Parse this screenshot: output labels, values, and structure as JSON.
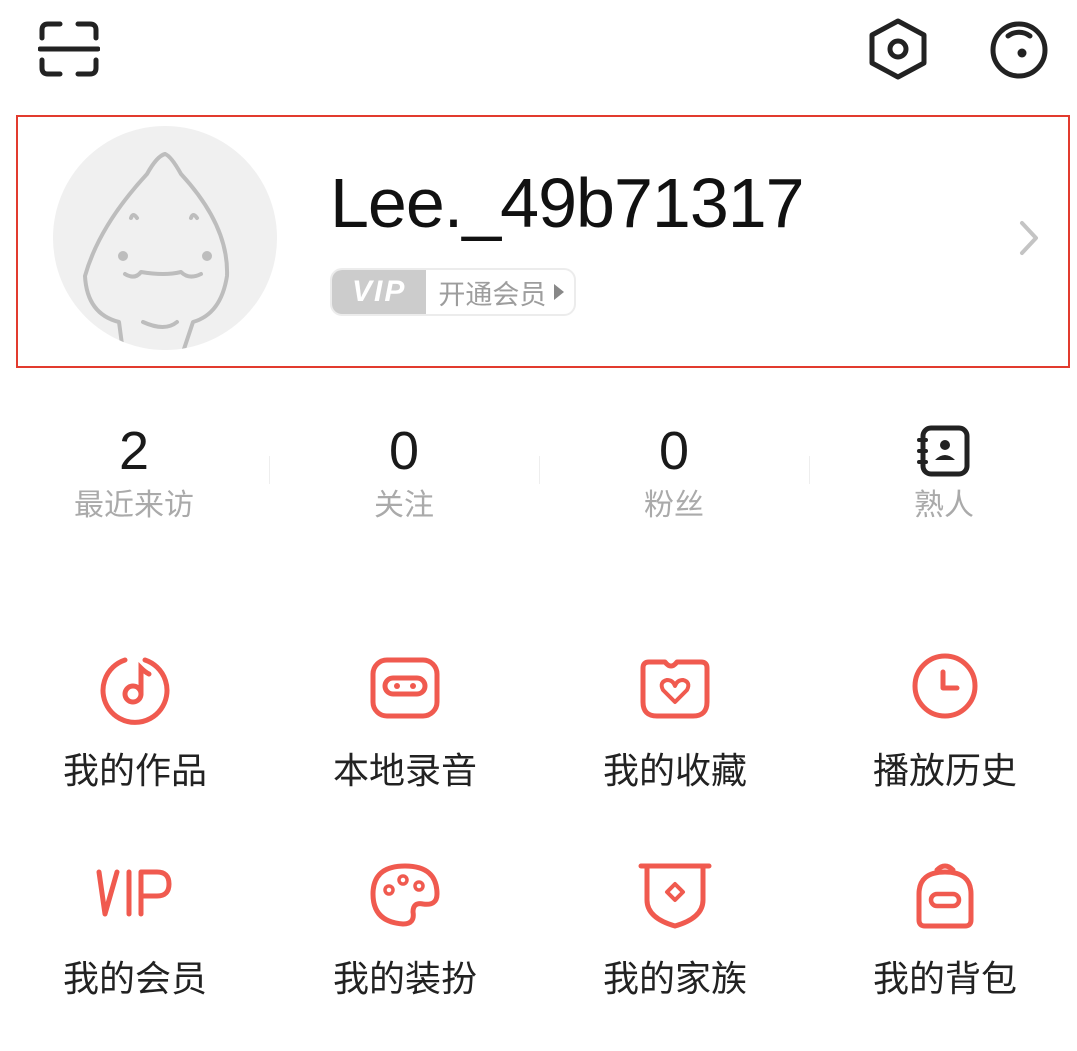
{
  "profile": {
    "username": "Lee._49b71317",
    "vip_badge": "VIP",
    "vip_action": "开通会员"
  },
  "stats": [
    {
      "value": "2",
      "label": "最近来访"
    },
    {
      "value": "0",
      "label": "关注"
    },
    {
      "value": "0",
      "label": "粉丝"
    },
    {
      "label": "熟人",
      "icon": "contacts-book-icon"
    }
  ],
  "menu": [
    {
      "label": "我的作品",
      "icon": "music-note-disc-icon"
    },
    {
      "label": "本地录音",
      "icon": "cassette-tape-icon"
    },
    {
      "label": "我的收藏",
      "icon": "heart-folder-icon"
    },
    {
      "label": "播放历史",
      "icon": "clock-icon"
    },
    {
      "label": "我的会员",
      "icon": "vip-text-icon"
    },
    {
      "label": "我的装扮",
      "icon": "palette-icon"
    },
    {
      "label": "我的家族",
      "icon": "shield-badge-icon"
    },
    {
      "label": "我的背包",
      "icon": "backpack-icon"
    }
  ],
  "colors": {
    "accent": "#f05a4f",
    "highlight_border": "#e23b2e",
    "muted_text": "#aaaaaa"
  }
}
